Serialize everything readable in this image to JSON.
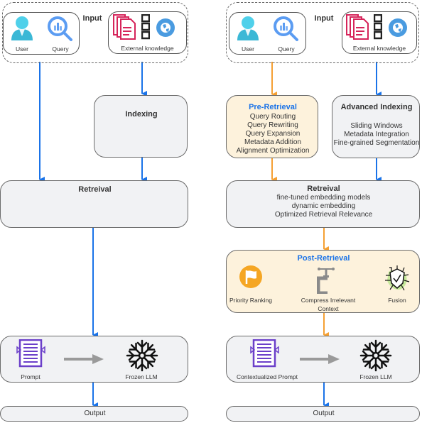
{
  "colors": {
    "blue_arrow": "#1a73e8",
    "orange_arrow": "#f5a033",
    "gray_box": "#f1f2f4",
    "warm_box": "#fdf2dc",
    "accent_blue": "#1a73e8",
    "prompt_purple": "#6b3fc9",
    "doc_red": "#d6245a",
    "globe_blue": "#4a9be0",
    "flag_orange": "#f5a623"
  },
  "left": {
    "input": {
      "title": "Input",
      "user_label": "User",
      "query_label": "Query",
      "external_label": "External knowledge"
    },
    "indexing": {
      "title": "Indexing"
    },
    "retrieval": {
      "title": "Retreival"
    },
    "generation": {
      "prompt_label": "Prompt",
      "llm_label": "Frozen LLM"
    },
    "output": {
      "title": "Output"
    }
  },
  "right": {
    "input": {
      "title": "Input",
      "user_label": "User",
      "query_label": "Query",
      "external_label": "External knowledge"
    },
    "pre_retrieval": {
      "title": "Pre-Retrieval",
      "items": [
        "Query Routing",
        "Query Rewriting",
        "Query Expansion",
        "Metadata Addition",
        "Alignment Optimization"
      ]
    },
    "advanced_indexing": {
      "title": "Advanced Indexing",
      "items": [
        "Sliding Windows",
        "Metadata Integration",
        "Fine-grained Segmentation"
      ]
    },
    "retrieval": {
      "title": "Retreival",
      "items": [
        "fine-tuned embedding models",
        "dynamic embedding",
        "Optimized Retrieval Relevance"
      ]
    },
    "post_retrieval": {
      "title": "Post-Retrieval",
      "priority_label": "Priority Ranking",
      "compress_label_1": "Compress Irrelevant",
      "compress_label_2": "Context",
      "fusion_label": "Fusion"
    },
    "generation": {
      "prompt_label": "Contextualized Prompt",
      "llm_label": "Frozen LLM"
    },
    "output": {
      "title": "Output"
    }
  }
}
